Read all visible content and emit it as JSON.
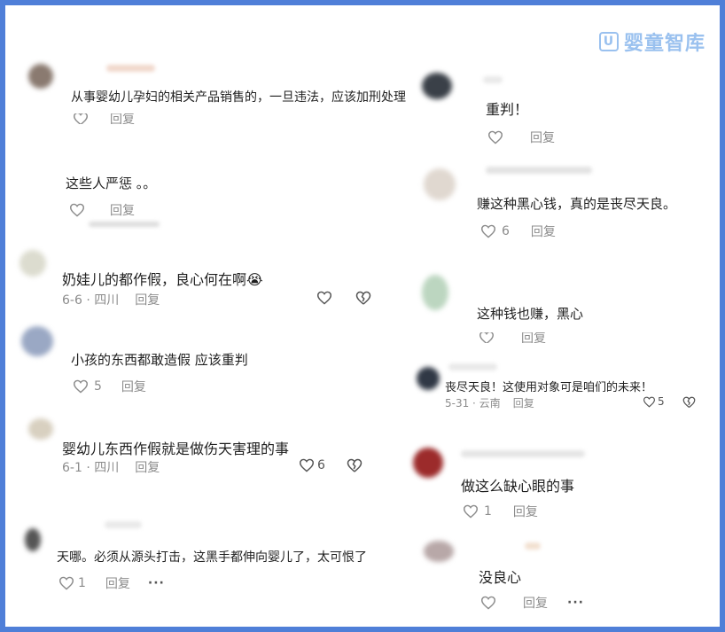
{
  "watermark": {
    "logo_char": "U",
    "text": "婴童智库"
  },
  "left_comments": [
    {
      "text": "从事婴幼儿孕妇的相关产品销售的，一旦违法，应该加刑处理",
      "reply": "回复"
    },
    {
      "text": "这些人严惩 。。",
      "reply": "回复"
    },
    {
      "text": "奶娃儿的都作假，良心何在啊😭",
      "meta": "6-6 · 四川",
      "reply": "回复"
    },
    {
      "text": "小孩的东西都敢造假 应该重判",
      "likes": "5",
      "reply": "回复"
    },
    {
      "text": "婴幼儿东西作假就是做伤天害理的事",
      "meta": "6-1 · 四川",
      "reply": "回复",
      "likes": "6"
    },
    {
      "text": "天哪。必须从源头打击，这黑手都伸向婴儿了，太可恨了",
      "likes": "1",
      "reply": "回复",
      "more": "···"
    }
  ],
  "right_comments": [
    {
      "text": "重判！",
      "reply": "回复"
    },
    {
      "text": "赚这种黑心钱，真的是丧尽天良。",
      "likes": "6",
      "reply": "回复"
    },
    {
      "text": "这种钱也赚，黑心",
      "reply": "回复"
    },
    {
      "text": "丧尽天良！这使用对象可是咱们的未来！",
      "meta": "5-31 · 云南",
      "reply": "回复",
      "likes": "5"
    },
    {
      "text": "做这么缺心眼的事",
      "likes": "1",
      "reply": "回复"
    },
    {
      "text": "没良心",
      "reply": "回复",
      "more": "···"
    }
  ]
}
